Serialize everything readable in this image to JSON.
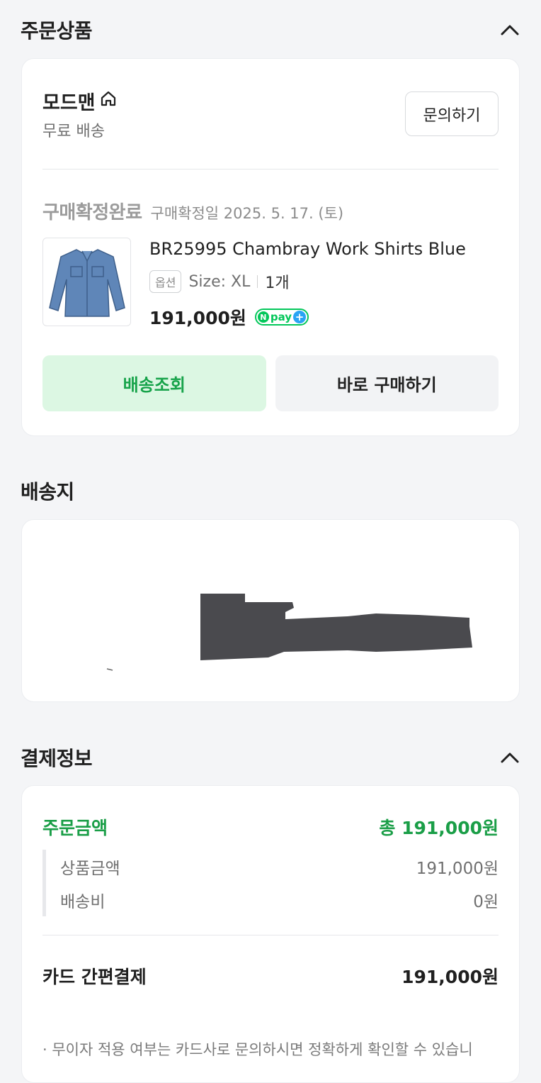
{
  "order_section": {
    "title": "주문상품",
    "store": {
      "name": "모드맨",
      "shipping": "무료 배송",
      "inquiry_label": "문의하기"
    },
    "status": {
      "label": "구매확정완료",
      "date": "구매확정일 2025. 5. 17. (토)"
    },
    "product": {
      "name": "BR25995 Chambray Work Shirts Blue",
      "option_badge": "옵션",
      "option_text": "Size: XL",
      "quantity": "1개",
      "price": "191,000원",
      "npay_text": "pay"
    },
    "buttons": {
      "track": "배송조회",
      "buy_again": "바로 구매하기"
    }
  },
  "shipping_section": {
    "title": "배송지"
  },
  "payment_section": {
    "title": "결제정보",
    "order_amount_label": "주문금액",
    "order_amount_total": "총 191,000원",
    "rows": [
      {
        "label": "상품금액",
        "value": "191,000원"
      },
      {
        "label": "배송비",
        "value": "0원"
      }
    ],
    "method_label": "카드 간편결제",
    "method_value": "191,000원",
    "note": "· 무이자 적용 여부는 카드사로 문의하시면 정확하게 확인할 수 있습니"
  },
  "colors": {
    "accent_green": "#1a9e47",
    "track_bg": "#dcf7e3",
    "npay_green": "#03c75a"
  },
  "icons": {
    "store": "home-icon",
    "collapse": "chevron-up-icon"
  }
}
